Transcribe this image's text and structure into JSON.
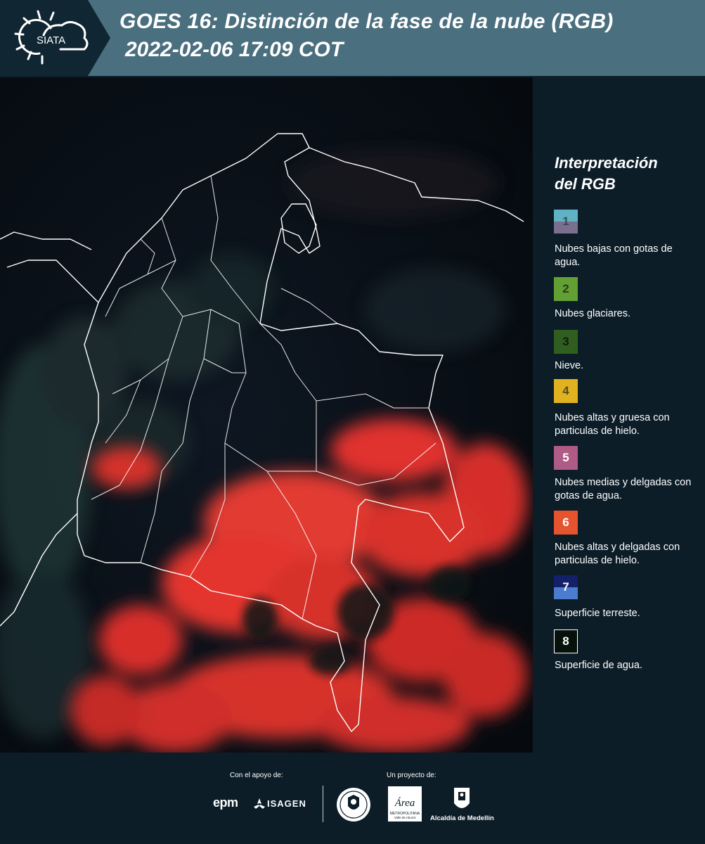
{
  "header": {
    "logo_text": "SIATA",
    "title_line1": "GOES 16: Distinción de la fase de la nube (RGB)",
    "title_line2": "2022-02-06 17:09 COT"
  },
  "legend": {
    "title_line1": "Interpretación",
    "title_line2": "del RGB",
    "items": [
      {
        "num": "1",
        "label": "Nubes bajas con gotas de agua."
      },
      {
        "num": "2",
        "label": "Nubes glaciares."
      },
      {
        "num": "3",
        "label": "Nieve."
      },
      {
        "num": "4",
        "label": "Nubes altas y gruesa con particulas de hielo."
      },
      {
        "num": "5",
        "label": "Nubes medias y delgadas con gotas de agua."
      },
      {
        "num": "6",
        "label": "Nubes altas y delgadas con particulas de hielo."
      },
      {
        "num": "7",
        "label": "Superficie terreste."
      },
      {
        "num": "8",
        "label": "Superficie de agua."
      }
    ],
    "colors": {
      "1_top": "#5fb3c4",
      "1_bottom": "#7a6f8f",
      "2": "#62a033",
      "3": "#2f5e1f",
      "4": "#e0b21f",
      "5": "#b05a86",
      "6": "#e5542e",
      "7_top": "#14206a",
      "7_bottom": "#4a7dd0",
      "8": "#05110a"
    }
  },
  "footer": {
    "support_label": "Con el apoyo de:",
    "project_label": "Un proyecto de:",
    "epm": "epm",
    "isagen": "ISAGEN",
    "metro_name": "Área",
    "metro_sub1": "METROPOLITANA",
    "metro_sub2": "Valle de Aburrá",
    "medellin": "Alcaldía de Medellín"
  }
}
